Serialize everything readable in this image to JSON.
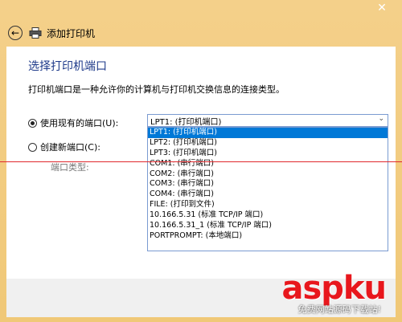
{
  "window": {
    "close_glyph": "✕"
  },
  "header": {
    "back_glyph": "←",
    "title": "添加打印机"
  },
  "main": {
    "heading": "选择打印机端口",
    "description": "打印机端口是一种允许你的计算机与打印机交换信息的连接类型。",
    "use_existing_label": "使用现有的端口(U):",
    "create_new_label": "创建新端口(C):",
    "port_type_label": "端口类型:",
    "selected_port": "LPT1: (打印机端口)",
    "port_options": [
      "LPT1: (打印机端口)",
      "LPT2: (打印机端口)",
      "LPT3: (打印机端口)",
      "COM1: (串行端口)",
      "COM2: (串行端口)",
      "COM3: (串行端口)",
      "COM4: (串行端口)",
      "FILE: (打印到文件)",
      "10.166.5.31 (标准 TCP/IP 端口)",
      "10.166.5.31_1 (标准 TCP/IP 端口)",
      "PORTPROMPT: (本地端口)"
    ],
    "highlighted_index": 0
  },
  "watermark": {
    "logo": "asp",
    "logo_suffix": "ku",
    "tagline": "免费网站源码下载站!"
  },
  "colors": {
    "accent": "#0078d7",
    "heading": "#1e3a8a",
    "frame": "#f0c877",
    "red_line": "#e0282d"
  }
}
